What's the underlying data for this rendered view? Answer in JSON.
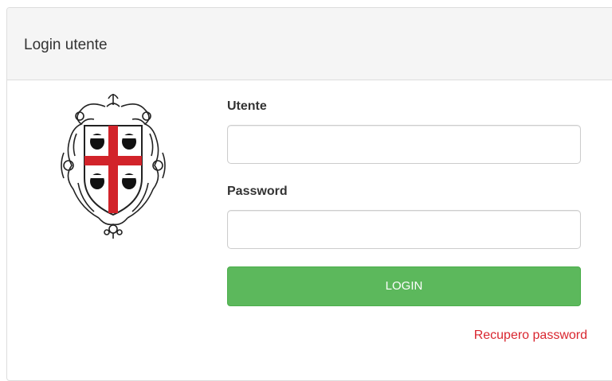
{
  "panel": {
    "title": "Login utente"
  },
  "emblem": {
    "icon": "sardinia-coat-of-arms-icon",
    "cross_color": "#d2232a"
  },
  "form": {
    "user_label": "Utente",
    "user_value": "",
    "password_label": "Password",
    "password_value": "",
    "login_button": "LOGIN",
    "login_button_color": "#5cb85c",
    "recover_link": "Recupero password",
    "recover_link_color": "#d9262f"
  }
}
